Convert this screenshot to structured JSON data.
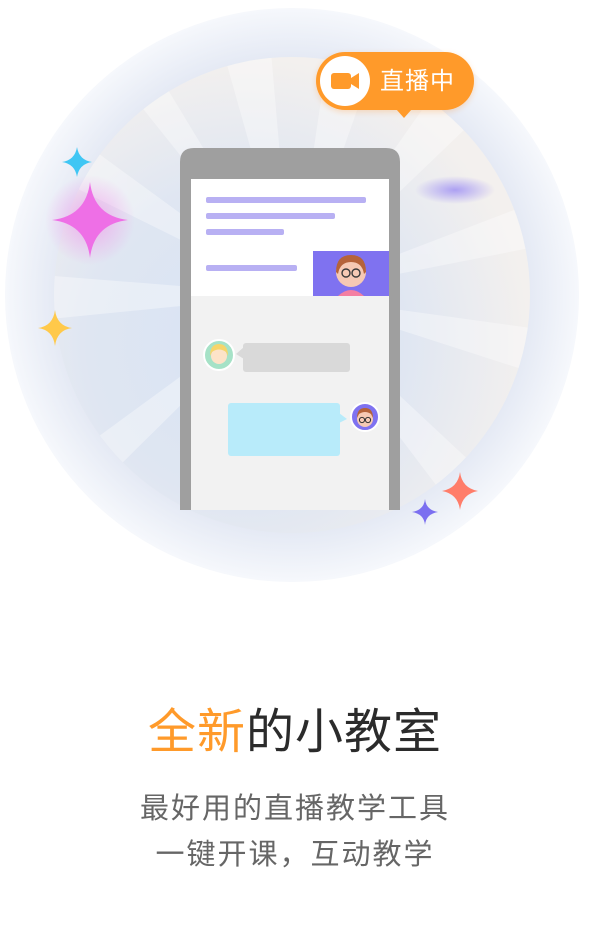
{
  "live_badge": {
    "label": "直播中",
    "icon": "video-camera-icon",
    "color": "#ff9a2a"
  },
  "title": {
    "accent": "全新",
    "rest": "的小教室",
    "accent_color": "#ff9a2a"
  },
  "subtitle": {
    "line1": "最好用的直播教学工具",
    "line2": "一键开课，互动教学"
  },
  "illustration": {
    "phone": "phone-icon",
    "avatars": [
      "teacher-avatar",
      "student-avatar"
    ],
    "sparkles": [
      "pink-sparkle",
      "blue-sparkle",
      "yellow-sparkle",
      "orange-sparkle",
      "purple-sparkle"
    ]
  }
}
